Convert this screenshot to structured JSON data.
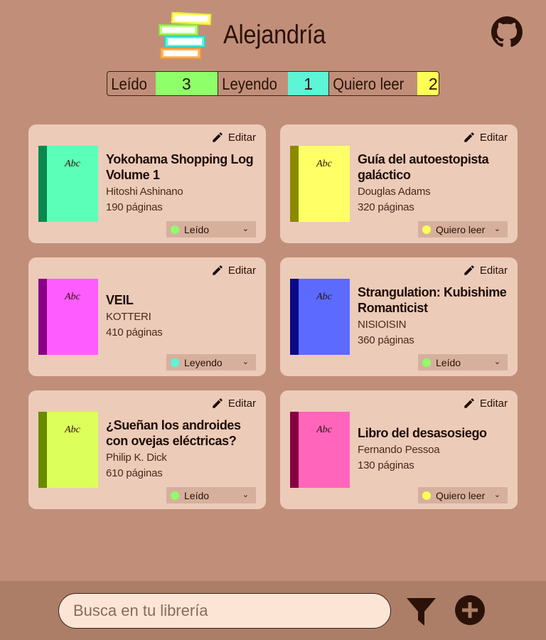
{
  "app": {
    "title": "Alejandría"
  },
  "stats": [
    {
      "label": "Leído",
      "count": "3",
      "color": "#8fff6a"
    },
    {
      "label": "Leyendo",
      "count": "1",
      "color": "#5cf5d6"
    },
    {
      "label": "Quiero leer",
      "count": "2",
      "color": "#ffff55"
    }
  ],
  "books": [
    {
      "title": "Yokohama Shopping Log Volume 1",
      "author": "Hitoshi Ashinano",
      "pages": "190 páginas",
      "status": "Leído",
      "status_color": "#8fff6a",
      "spine": "#08884e",
      "cover": "#5cffb8",
      "cover_text": "Abc"
    },
    {
      "title": "Guía del autoestopista galáctico",
      "author": "Douglas Adams",
      "pages": "320 páginas",
      "status": "Quiero leer",
      "status_color": "#ffff55",
      "spine": "#8a8a00",
      "cover": "#ffff66",
      "cover_text": "Abc"
    },
    {
      "title": "VEIL",
      "author": "KOTTERI",
      "pages": "410 páginas",
      "status": "Leyendo",
      "status_color": "#5cf5d6",
      "spine": "#880088",
      "cover": "#ff5cff",
      "cover_text": "Abc"
    },
    {
      "title": "Strangulation: Kubishime Romanticist",
      "author": "NISIOISIN",
      "pages": "360 páginas",
      "status": "Leído",
      "status_color": "#8fff6a",
      "spine": "#0a0a88",
      "cover": "#5c6aff",
      "cover_text": "Abc"
    },
    {
      "title": "¿Sueñan los androides con ovejas eléctricas?",
      "author": "Philip K. Dick",
      "pages": "610 páginas",
      "status": "Leído",
      "status_color": "#8fff6a",
      "spine": "#6a8a00",
      "cover": "#ddff5c",
      "cover_text": "Abc"
    },
    {
      "title": "Libro del desasosiego",
      "author": "Fernando Pessoa",
      "pages": "130 páginas",
      "status": "Quiero leer",
      "status_color": "#ffff55",
      "spine": "#880044",
      "cover": "#ff66bb",
      "cover_text": "Abc"
    }
  ],
  "card": {
    "edit_label": "Editar"
  },
  "search": {
    "placeholder": "Busca en tu librería",
    "value": ""
  },
  "icons": {
    "logo": "books-stack-logo",
    "github": "github-icon",
    "edit": "pencil-icon",
    "filter": "filter-icon",
    "add": "add-circle-icon",
    "chevron": "chevron-down-icon"
  }
}
